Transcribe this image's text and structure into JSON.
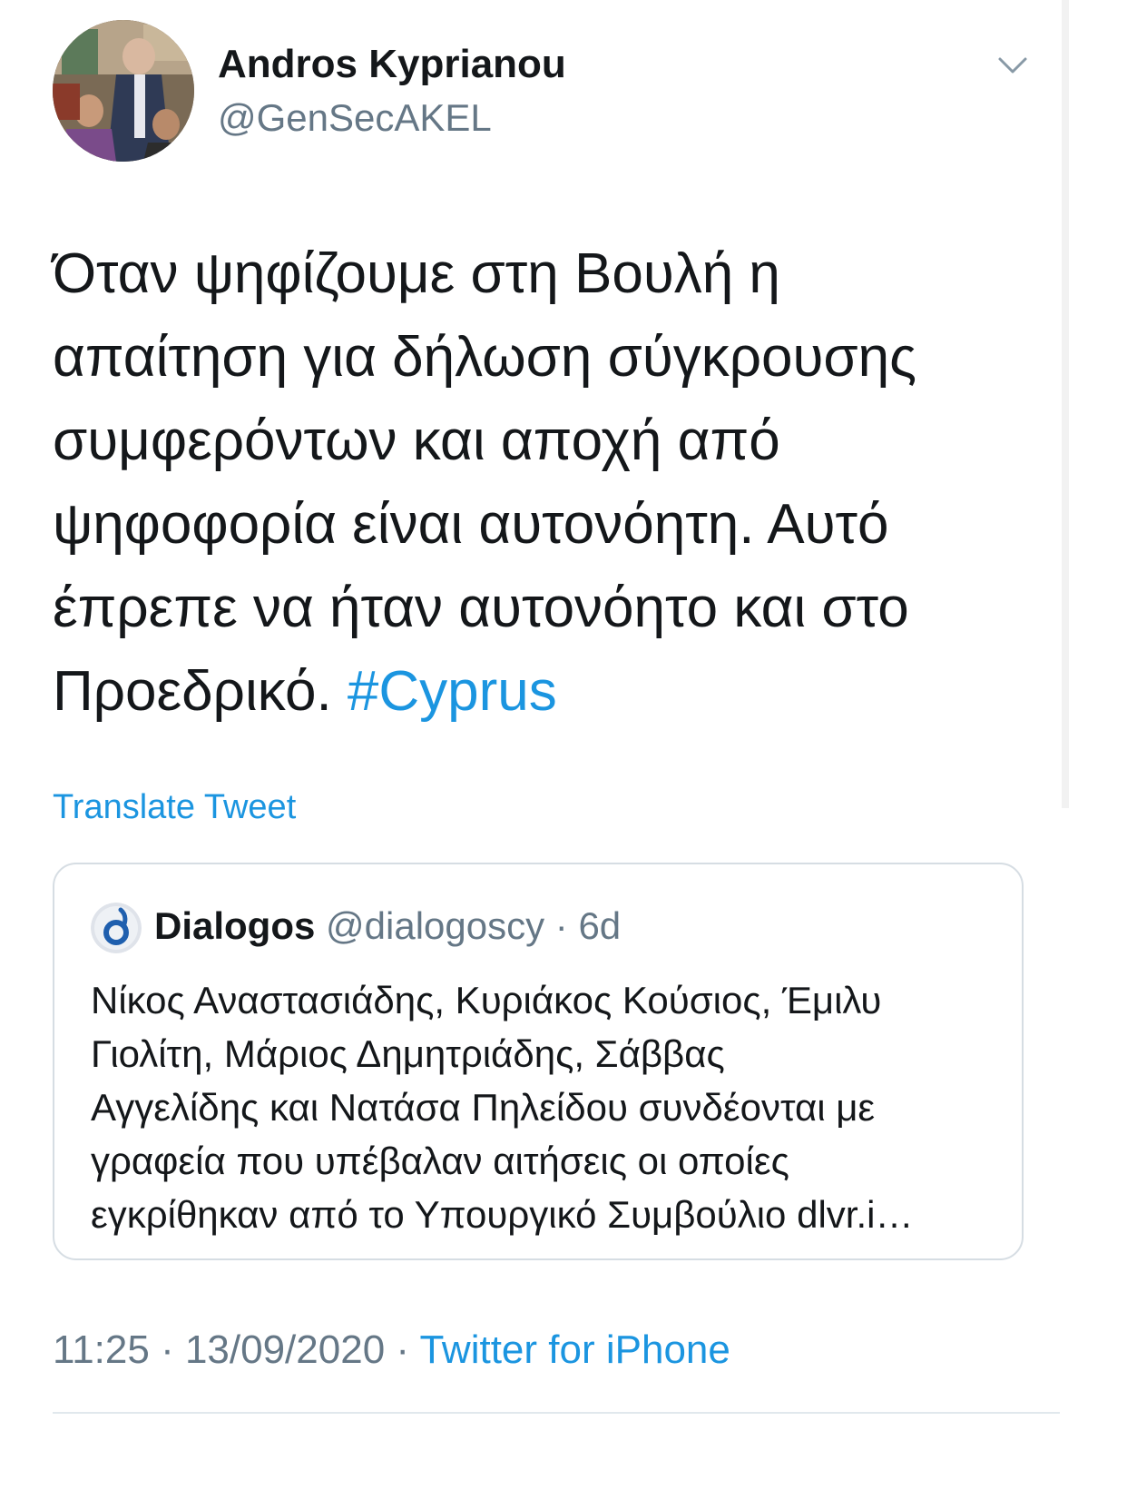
{
  "author": {
    "name": "Andros Kyprianou",
    "handle": "@GenSecAKEL"
  },
  "tweet": {
    "lines": [
      "Όταν ψηφίζουμε στη Βουλή η",
      "απαίτηση για δήλωση σύγκρουσης",
      "συμφερόντων και αποχή από",
      "ψηφοφορία είναι αυτονόητη. Αυτό",
      "έπρεπε να ήταν αυτονόητο και στο",
      "Προεδρικό."
    ],
    "hashtag": "#Cyprus"
  },
  "translate_label": "Translate Tweet",
  "quoted": {
    "name": "Dialogos",
    "handle": "@dialogoscy",
    "separator": " · ",
    "age": "6d",
    "lines": [
      "Νίκος Αναστασιάδης, Κυριάκος Κούσιος, Έμιλυ",
      "Γιολίτη, Μάριος Δημητριάδης, Σάββας",
      "Αγγελίδης και Νατάσα Πηλείδου συνδέονται με",
      "γραφεία που υπέβαλαν αιτήσεις οι οποίες",
      "εγκρίθηκαν από το Υπουργικό Συμβούλιο dlvr.i…"
    ]
  },
  "footer": {
    "time": "11:25",
    "separator": " · ",
    "date": "13/09/2020",
    "source": "Twitter for iPhone"
  },
  "colors": {
    "link": "#1b95e0",
    "secondary_text": "#657786",
    "primary_text": "#14171a",
    "border": "#d6dde3"
  },
  "icons": {
    "chevron": "chevron-down-icon",
    "quote_avatar": "dialogos-logo-icon"
  }
}
